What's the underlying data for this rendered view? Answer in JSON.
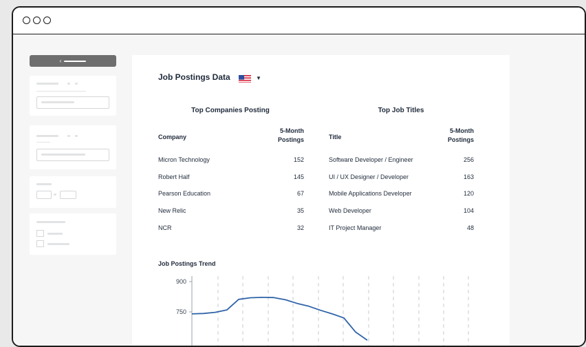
{
  "colors": {
    "line": "#2f63a8",
    "text": "#1f2a3a",
    "grid": "#c7cbd1"
  },
  "header": {
    "title": "Job Postings Data",
    "flag_icon": "us-flag-icon"
  },
  "companies": {
    "title": "Top Companies Posting",
    "col_name": "Company",
    "col_value_line1": "5-Month",
    "col_value_line2": "Postings",
    "rows": [
      {
        "name": "Micron Technology",
        "value": "152"
      },
      {
        "name": "Robert Half",
        "value": "145"
      },
      {
        "name": "Pearson Education",
        "value": "67"
      },
      {
        "name": "New Relic",
        "value": "35"
      },
      {
        "name": "NCR",
        "value": "32"
      }
    ]
  },
  "titles": {
    "title": "Top Job Titles",
    "col_name": "Title",
    "col_value_line1": "5-Month",
    "col_value_line2": "Postings",
    "rows": [
      {
        "name": "Software Developer / Engineer",
        "value": "256"
      },
      {
        "name": "UI / UX Designer / Developer",
        "value": "163"
      },
      {
        "name": "Mobile Applications Developer",
        "value": "120"
      },
      {
        "name": "Web Developer",
        "value": "104"
      },
      {
        "name": "IT Project Manager",
        "value": "48"
      }
    ]
  },
  "trend": {
    "title": "Job Postings Trend",
    "y_ticks": [
      "900",
      "750"
    ]
  },
  "chart_data": {
    "type": "line",
    "title": "Job Postings Trend",
    "xlabel": "",
    "ylabel": "",
    "grid": "vertical dashed",
    "ylim": [
      600,
      900
    ],
    "y_ticks": [
      900,
      750
    ],
    "x": [
      0,
      1,
      2,
      3,
      4,
      5,
      6,
      7,
      8,
      9,
      10,
      11,
      12,
      13,
      14,
      15
    ],
    "series": [
      {
        "values": [
          740,
          742,
          748,
          760,
          812,
          820,
          822,
          821,
          810,
          792,
          778,
          758,
          740,
          720,
          650,
          610
        ]
      }
    ]
  }
}
